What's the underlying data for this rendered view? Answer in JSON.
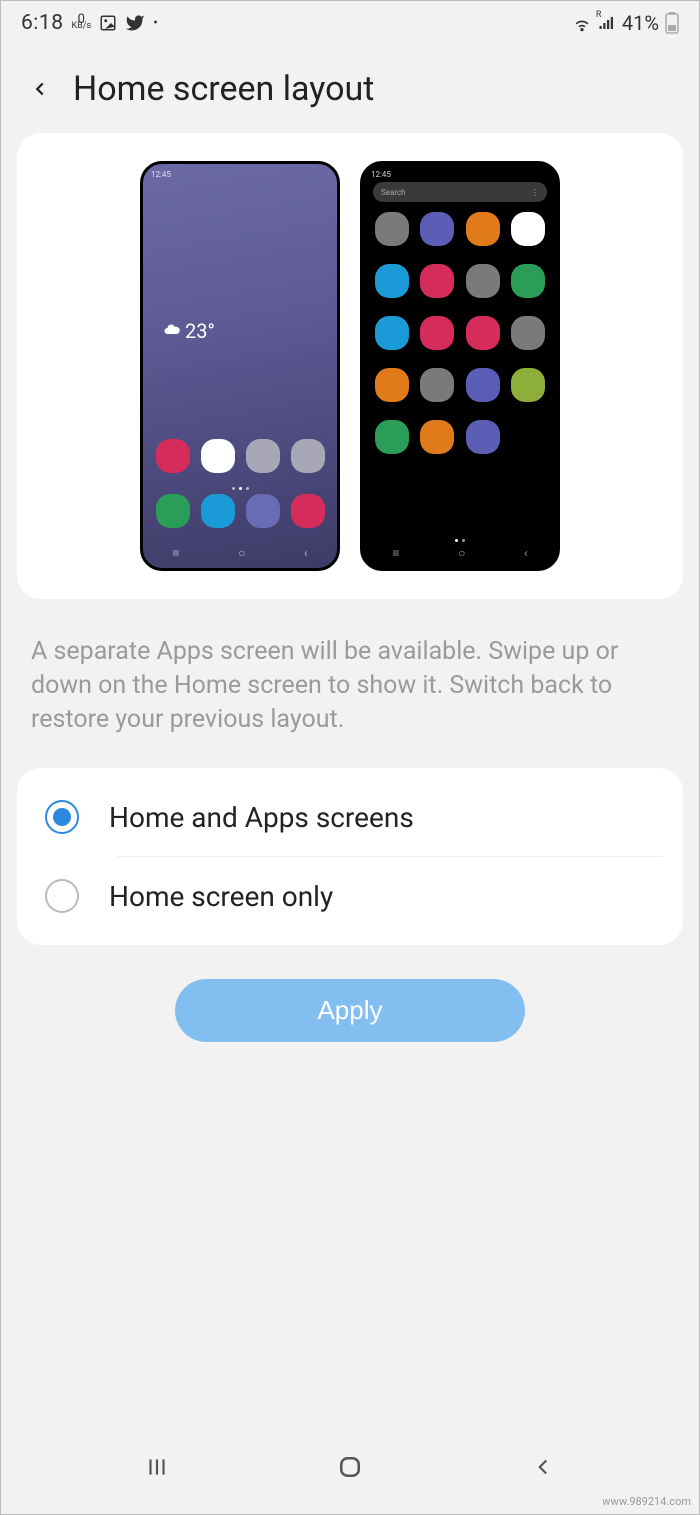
{
  "status": {
    "time": "6:18",
    "kb_value": "0",
    "kb_label": "KB/s",
    "signal_letter": "R",
    "battery_percent": "41%"
  },
  "header": {
    "title": "Home screen layout"
  },
  "preview": {
    "mini_time": "12:45",
    "weather_temp": "23°",
    "search_label": "Search",
    "home_row1_colors": [
      "#d62c5c",
      "#ffffff",
      "#a8a7b8",
      "#a8a7b8"
    ],
    "home_row2_colors": [
      "#2a9e58",
      "#1a9bd7",
      "#6a6bb5",
      "#d62c5c"
    ],
    "apps_grid_colors": [
      "#7a7a7a",
      "#5a5fb5",
      "#e07a1a",
      "#ffffff",
      "#1a9bd7",
      "#d62c5c",
      "#7a7a7a",
      "#2a9e58",
      "#1a9bd7",
      "#d62c5c",
      "#d62c5c",
      "#7a7a7a",
      "#e07a1a",
      "#7a7a7a",
      "#5a5fb5",
      "#8eae3a",
      "#2a9e58",
      "#e07a1a",
      "#5a5fb5"
    ]
  },
  "description": "A separate Apps screen will be available. Swipe up or down on the Home screen to show it. Switch back to restore your previous layout.",
  "options": [
    {
      "label": "Home and Apps screens",
      "checked": true
    },
    {
      "label": "Home screen only",
      "checked": false
    }
  ],
  "apply_label": "Apply",
  "watermark": "www.989214.com"
}
